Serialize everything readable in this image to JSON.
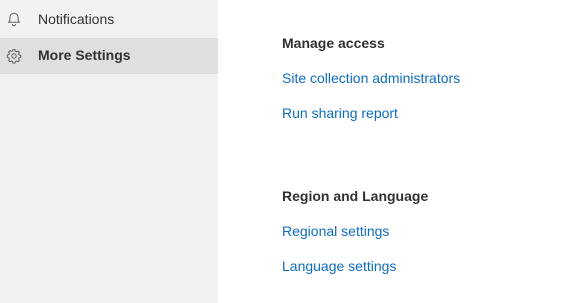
{
  "sidebar": {
    "items": [
      {
        "label": "Notifications",
        "icon": "bell-icon",
        "selected": false
      },
      {
        "label": "More Settings",
        "icon": "gear-icon",
        "selected": true
      }
    ]
  },
  "main": {
    "sections": [
      {
        "title": "Manage access",
        "links": [
          "Site collection administrators",
          "Run sharing report"
        ]
      },
      {
        "title": "Region and Language",
        "links": [
          "Regional settings",
          "Language settings"
        ]
      }
    ]
  },
  "colors": {
    "sidebar_bg": "#f3f2f1",
    "selected_bg": "#e1dfdd",
    "link": "#0f6cbd",
    "text": "#323130"
  }
}
